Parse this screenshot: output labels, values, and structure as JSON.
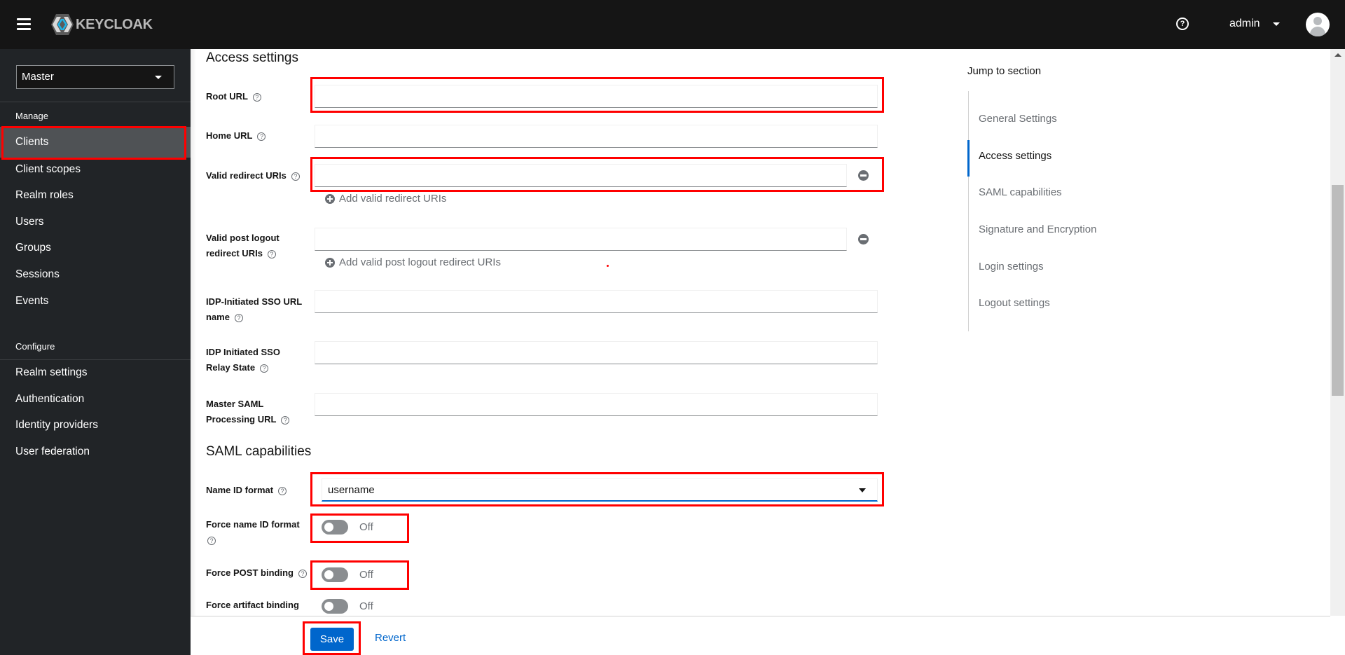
{
  "header": {
    "brand": "KEYCLOAK",
    "help_icon": "question-circle-icon",
    "user_name": "admin",
    "avatar_icon": "user-avatar-icon"
  },
  "sidebar": {
    "realm": "Master",
    "manage_label": "Manage",
    "manage_items": [
      {
        "label": "Clients",
        "active": true
      },
      {
        "label": "Client scopes"
      },
      {
        "label": "Realm roles"
      },
      {
        "label": "Users"
      },
      {
        "label": "Groups"
      },
      {
        "label": "Sessions"
      },
      {
        "label": "Events"
      }
    ],
    "configure_label": "Configure",
    "configure_items": [
      {
        "label": "Realm settings"
      },
      {
        "label": "Authentication"
      },
      {
        "label": "Identity providers"
      },
      {
        "label": "User federation"
      }
    ]
  },
  "access_settings": {
    "title": "Access settings",
    "root_url": {
      "label": "Root URL",
      "value": ""
    },
    "home_url": {
      "label": "Home URL",
      "value": ""
    },
    "valid_redirect_uris": {
      "label": "Valid redirect URIs",
      "value": "",
      "add_label": "Add valid redirect URIs"
    },
    "valid_post_logout": {
      "label_line1": "Valid post logout",
      "label_line2": "redirect URIs",
      "value": "",
      "add_label": "Add valid post logout redirect URIs"
    },
    "idp_sso_url_name": {
      "label_line1": "IDP-Initiated SSO URL",
      "label_line2": "name",
      "value": ""
    },
    "idp_relay_state": {
      "label_line1": "IDP Initiated SSO",
      "label_line2": "Relay State",
      "value": ""
    },
    "master_saml_url": {
      "label_line1": "Master SAML",
      "label_line2": "Processing URL",
      "value": ""
    }
  },
  "saml_capabilities": {
    "title": "SAML capabilities",
    "name_id_format": {
      "label": "Name ID format",
      "value": "username"
    },
    "force_name_id_format": {
      "label": "Force name ID format",
      "state": "Off"
    },
    "force_post_binding": {
      "label": "Force POST binding",
      "state": "Off"
    },
    "force_artifact_binding": {
      "label": "Force artifact binding",
      "state": "Off"
    }
  },
  "jump_to_section": {
    "title": "Jump to section",
    "items": [
      {
        "label": "General Settings"
      },
      {
        "label": "Access settings",
        "active": true
      },
      {
        "label": "SAML capabilities"
      },
      {
        "label": "Signature and Encryption"
      },
      {
        "label": "Login settings"
      },
      {
        "label": "Logout settings"
      }
    ]
  },
  "footer": {
    "save_label": "Save",
    "revert_label": "Revert"
  },
  "colors": {
    "header_bg": "#151515",
    "sidebar_bg": "#212427",
    "active_item_bg": "#4f5255",
    "primary": "#0066cc",
    "highlight": "#ff0000"
  }
}
